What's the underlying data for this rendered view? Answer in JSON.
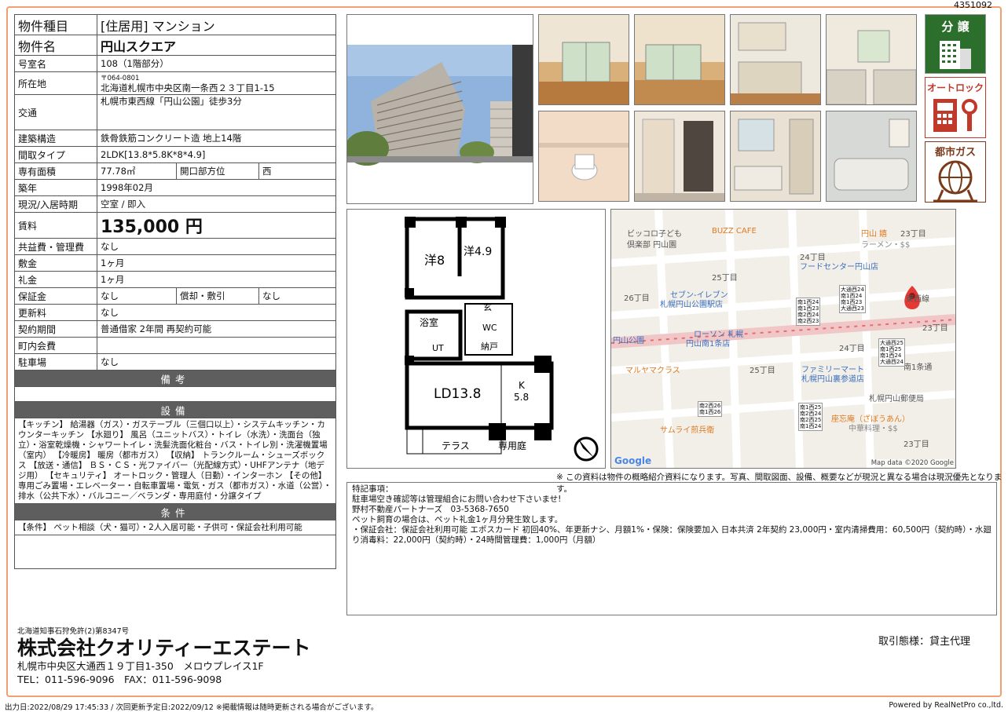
{
  "listing_no": "4351092",
  "rows": [
    {
      "k": "物件種目",
      "v": "[住居用] マンション"
    },
    {
      "k": "物件名",
      "v": "円山スクエア"
    },
    {
      "k": "号室名",
      "v": "108（1階部分）"
    },
    {
      "k": "所在地",
      "zip": "〒064-0801",
      "v": "北海道札幌市中央区南一条西２３丁目1-15"
    },
    {
      "k": "交通",
      "v": "札幌市東西線「円山公園」徒歩3分"
    },
    {
      "k": "建築構造",
      "v": "鉄骨鉄筋コンクリート造 地上14階"
    },
    {
      "k": "間取タイプ",
      "v": "2LDK[13.8*5.8K*8*4.9]"
    },
    {
      "k": "専有面積",
      "v": "77.78㎡",
      "k2": "開口部方位",
      "v2": "西"
    },
    {
      "k": "築年",
      "v": "1998年02月"
    },
    {
      "k": "現況/入居時期",
      "v": "空室 / 即入"
    },
    {
      "k": "賃料",
      "v": "135,000 円"
    },
    {
      "k": "共益費・管理費",
      "v": "なし"
    },
    {
      "k": "敷金",
      "v": "1ヶ月"
    },
    {
      "k": "礼金",
      "v": "1ヶ月"
    },
    {
      "k": "保証金",
      "v": "なし",
      "k2": "償却・敷引",
      "v2": "なし"
    },
    {
      "k": "更新料",
      "v": "なし"
    },
    {
      "k": "契約期間",
      "v": "普通借家 2年間 再契約可能"
    },
    {
      "k": "町内会費",
      "v": ""
    },
    {
      "k": "駐車場",
      "v": "なし"
    }
  ],
  "sections": {
    "remarks": "備考",
    "equipment": "設備",
    "conditions": "条件"
  },
  "equipment_text": "【キッチン】 給湯器（ガス）・ガステーブル（三個口以上）・システムキッチン・カウンターキッチン 【水廻り】 風呂（ユニットバス）・トイレ（水洗）・洗面台（独立）・浴室乾燥機・シャワートイレ・洗髪洗面化粧台・バス・トイレ別・洗濯機置場（室内） 【冷暖房】 暖房（都市ガス） 【収納】 トランクルーム・シューズボックス 【放送・通信】 ＢＳ・ＣＳ・光ファイバー（光配線方式）・UHFアンテナ（地デジ用） 【セキュリティ】 オートロック・管理人（日勤）・インターホン 【その他】 専用ごみ置場・エレベーター・自転車置場・電気・ガス（都市ガス）・水道（公営）・排水（公共下水）・バルコニー／ベランダ・専用庭付・分譲タイプ",
  "conditions_text": "【条件】 ペット相談（犬・猫可）・2人入居可能・子供可・保証会社利用可能",
  "badges": [
    "分 譲",
    "オートロック",
    "都市ガス"
  ],
  "floorplan": {
    "r1": "洋8",
    "r2": "洋4.9",
    "bath": "浴室",
    "genkan": "玄",
    "wc": "WC",
    "ut": "UT",
    "nando": "納戸",
    "ld": "LD13.8",
    "k": "K",
    "k2": "5.8",
    "terrace": "テラス",
    "garden": "専用庭"
  },
  "map": {
    "copyright": "Map data ©2020 Google",
    "google": "Google",
    "labels": [
      {
        "t": "ビッコロ子ども",
        "c": "#555"
      },
      {
        "t": "倶楽部 円山園",
        "c": "#555"
      },
      {
        "t": "BUZZ CAFE",
        "c": "#e07a20"
      },
      {
        "t": "円山 嬉",
        "c": "#e07a20"
      },
      {
        "t": "ラーメン・$$",
        "c": "#888"
      },
      {
        "t": "23丁目",
        "c": "#555"
      },
      {
        "t": "24丁目",
        "c": "#555"
      },
      {
        "t": "フードセンター円山店",
        "c": "#3b6fc0"
      },
      {
        "t": "25丁目",
        "c": "#555"
      },
      {
        "t": "セブン-イレブン",
        "c": "#3b6fc0"
      },
      {
        "t": "札幌円山公園駅店",
        "c": "#3b6fc0"
      },
      {
        "t": "26丁目",
        "c": "#555"
      },
      {
        "t": "東西線",
        "c": "#555"
      },
      {
        "t": "23丁目",
        "c": "#555"
      },
      {
        "t": "円山公園",
        "c": "#3b6fc0"
      },
      {
        "t": "ローソン 札幌",
        "c": "#3b6fc0"
      },
      {
        "t": "円山南1条店",
        "c": "#3b6fc0"
      },
      {
        "t": "24丁目",
        "c": "#555"
      },
      {
        "t": "マルヤマクラス",
        "c": "#e07a20"
      },
      {
        "t": "25丁目",
        "c": "#555"
      },
      {
        "t": "ファミリーマート",
        "c": "#3b6fc0"
      },
      {
        "t": "札幌円山裏参道店",
        "c": "#3b6fc0"
      },
      {
        "t": "南1条通",
        "c": "#555"
      },
      {
        "t": "札幌円山郵便局",
        "c": "#555"
      },
      {
        "t": "サムライ煎兵衛",
        "c": "#e07a20"
      },
      {
        "t": "座忘庵（ざぼうあん）",
        "c": "#e07a20"
      },
      {
        "t": "中華料理・$$",
        "c": "#888"
      },
      {
        "t": "23丁目",
        "c": "#555"
      }
    ],
    "signs": [
      [
        "大通西24",
        "南1西24",
        "南1西23",
        "大通西23"
      ],
      [
        "大通西25",
        "南1西25",
        "南1西24",
        "大通西24"
      ],
      [
        "南1西24",
        "南1西23",
        "南2西24",
        "南2西23"
      ],
      [
        "南2西26",
        "南1西26"
      ],
      [
        "南1西25",
        "南2西24",
        "南2西25",
        "南1西24"
      ]
    ]
  },
  "map_note": "※ この資料は物件の概略紹介資料になります。写真、間取図面、設備、概要などが現況と異なる場合は現況優先となります。",
  "remarks": [
    "特記事項：",
    "駐車場空き確認等は管理組合にお問い合わせ下さいませ!",
    "野村不動産パートナーズ　03-5368-7650",
    "ペット飼育の場合は、ペット礼金1ヶ月分発生致します。",
    "・保証会社：保証会社利用可能 エポスカード 初回40%、年更新ナシ、月額1%・保険：保険要加入 日本共済 2年契約 23,000円・室内清掃費用：60,500円（契約時）・水廻り消毒料：22,000円（契約時）・24時間管理費：1,000円（月額）"
  ],
  "company": {
    "license": "北海道知事石狩免許(2)第8347号",
    "name": "株式会社クオリティーエステート",
    "address": "札幌市中央区大通西１９丁目1-350　メロウプレイス1F",
    "phone": "TEL：011-596-9096　FAX：011-596-9098",
    "transaction": "取引態様：貸主代理"
  },
  "footer": {
    "output": "出力日:2022/08/29 17:45:33 / 次回更新予定日:2022/09/12 ※掲載情報は随時更新される場合がございます。",
    "powered": "Powered by RealNetPro co.,ltd."
  }
}
